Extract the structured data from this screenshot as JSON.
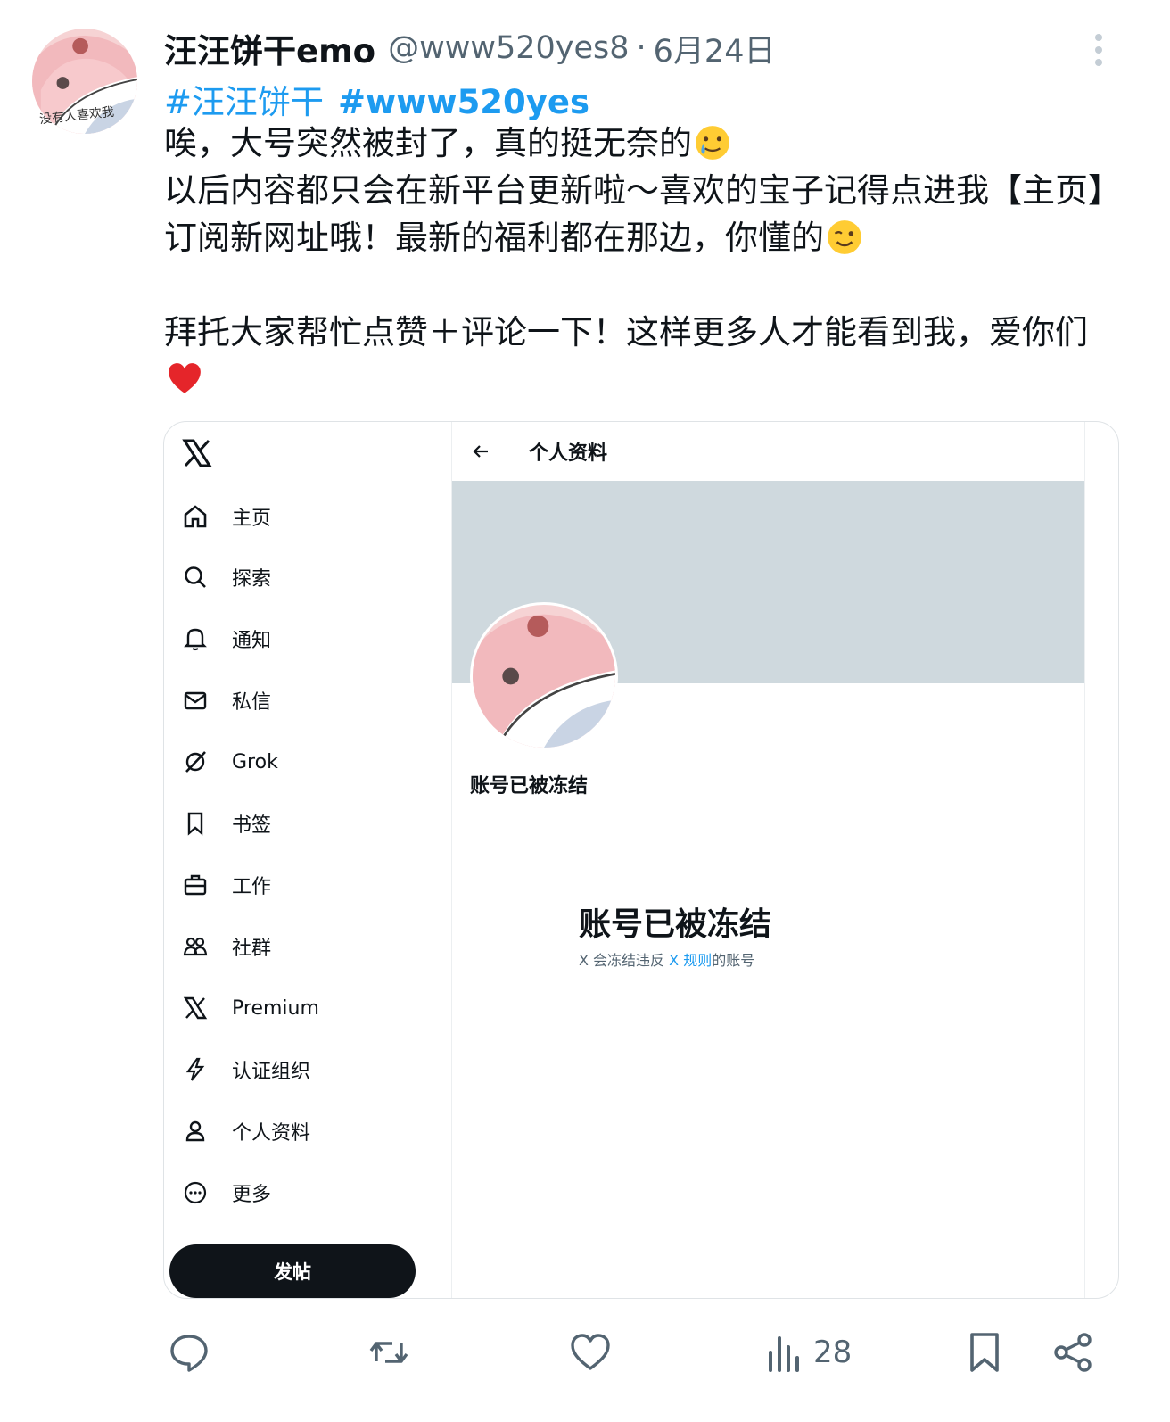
{
  "post": {
    "author_name": "汪汪饼干emo",
    "handle": "@www520yes8",
    "separator": "·",
    "date": "6月24日",
    "hashtags": [
      "#汪汪饼干",
      "#www520yes"
    ],
    "avatar_caption": "没有人喜欢我",
    "body": {
      "line1": "唉，大号突然被封了，真的挺无奈的",
      "line1_emoji": "tear-smile-emoji",
      "line2": "以后内容都只会在新平台更新啦～喜欢的宝子记得点进我【主页】订阅新网址哦！最新的福利都在那边，你懂的",
      "line2_emoji": "wink-emoji",
      "line3": "拜托大家帮忙点赞＋评论一下！这样更多人才能看到我，爱你们",
      "line3_emoji": "red-heart-emoji"
    }
  },
  "embedded_screenshot": {
    "logo": "x-logo-icon",
    "nav": [
      {
        "icon": "home-icon",
        "label": "主页"
      },
      {
        "icon": "search-icon",
        "label": "探索"
      },
      {
        "icon": "bell-icon",
        "label": "通知"
      },
      {
        "icon": "mail-icon",
        "label": "私信"
      },
      {
        "icon": "grok-icon",
        "label": "Grok"
      },
      {
        "icon": "bookmark-icon",
        "label": "书签"
      },
      {
        "icon": "briefcase-icon",
        "label": "工作"
      },
      {
        "icon": "community-icon",
        "label": "社群"
      },
      {
        "icon": "x-premium-icon",
        "label": "Premium"
      },
      {
        "icon": "lightning-icon",
        "label": "认证组织"
      },
      {
        "icon": "person-icon",
        "label": "个人资料"
      },
      {
        "icon": "more-circle-icon",
        "label": "更多"
      }
    ],
    "post_button": "发帖",
    "header_title": "个人资料",
    "frozen_label": "账号已被冻结",
    "frozen_heading": "账号已被冻结",
    "frozen_note_before": "X 会冻结违反 ",
    "frozen_note_link": "X 规则",
    "frozen_note_after": "的账号"
  },
  "actions": {
    "reply_icon": "reply-icon",
    "repost_icon": "repost-icon",
    "like_icon": "heart-icon",
    "views_icon": "views-chart-icon",
    "views_count": "28",
    "bookmark_icon": "bookmark-icon",
    "share_icon": "share-icon"
  },
  "colors": {
    "accent": "#1d9bf0",
    "text": "#0f1419",
    "muted": "#536471",
    "banner": "#cfd9de"
  }
}
